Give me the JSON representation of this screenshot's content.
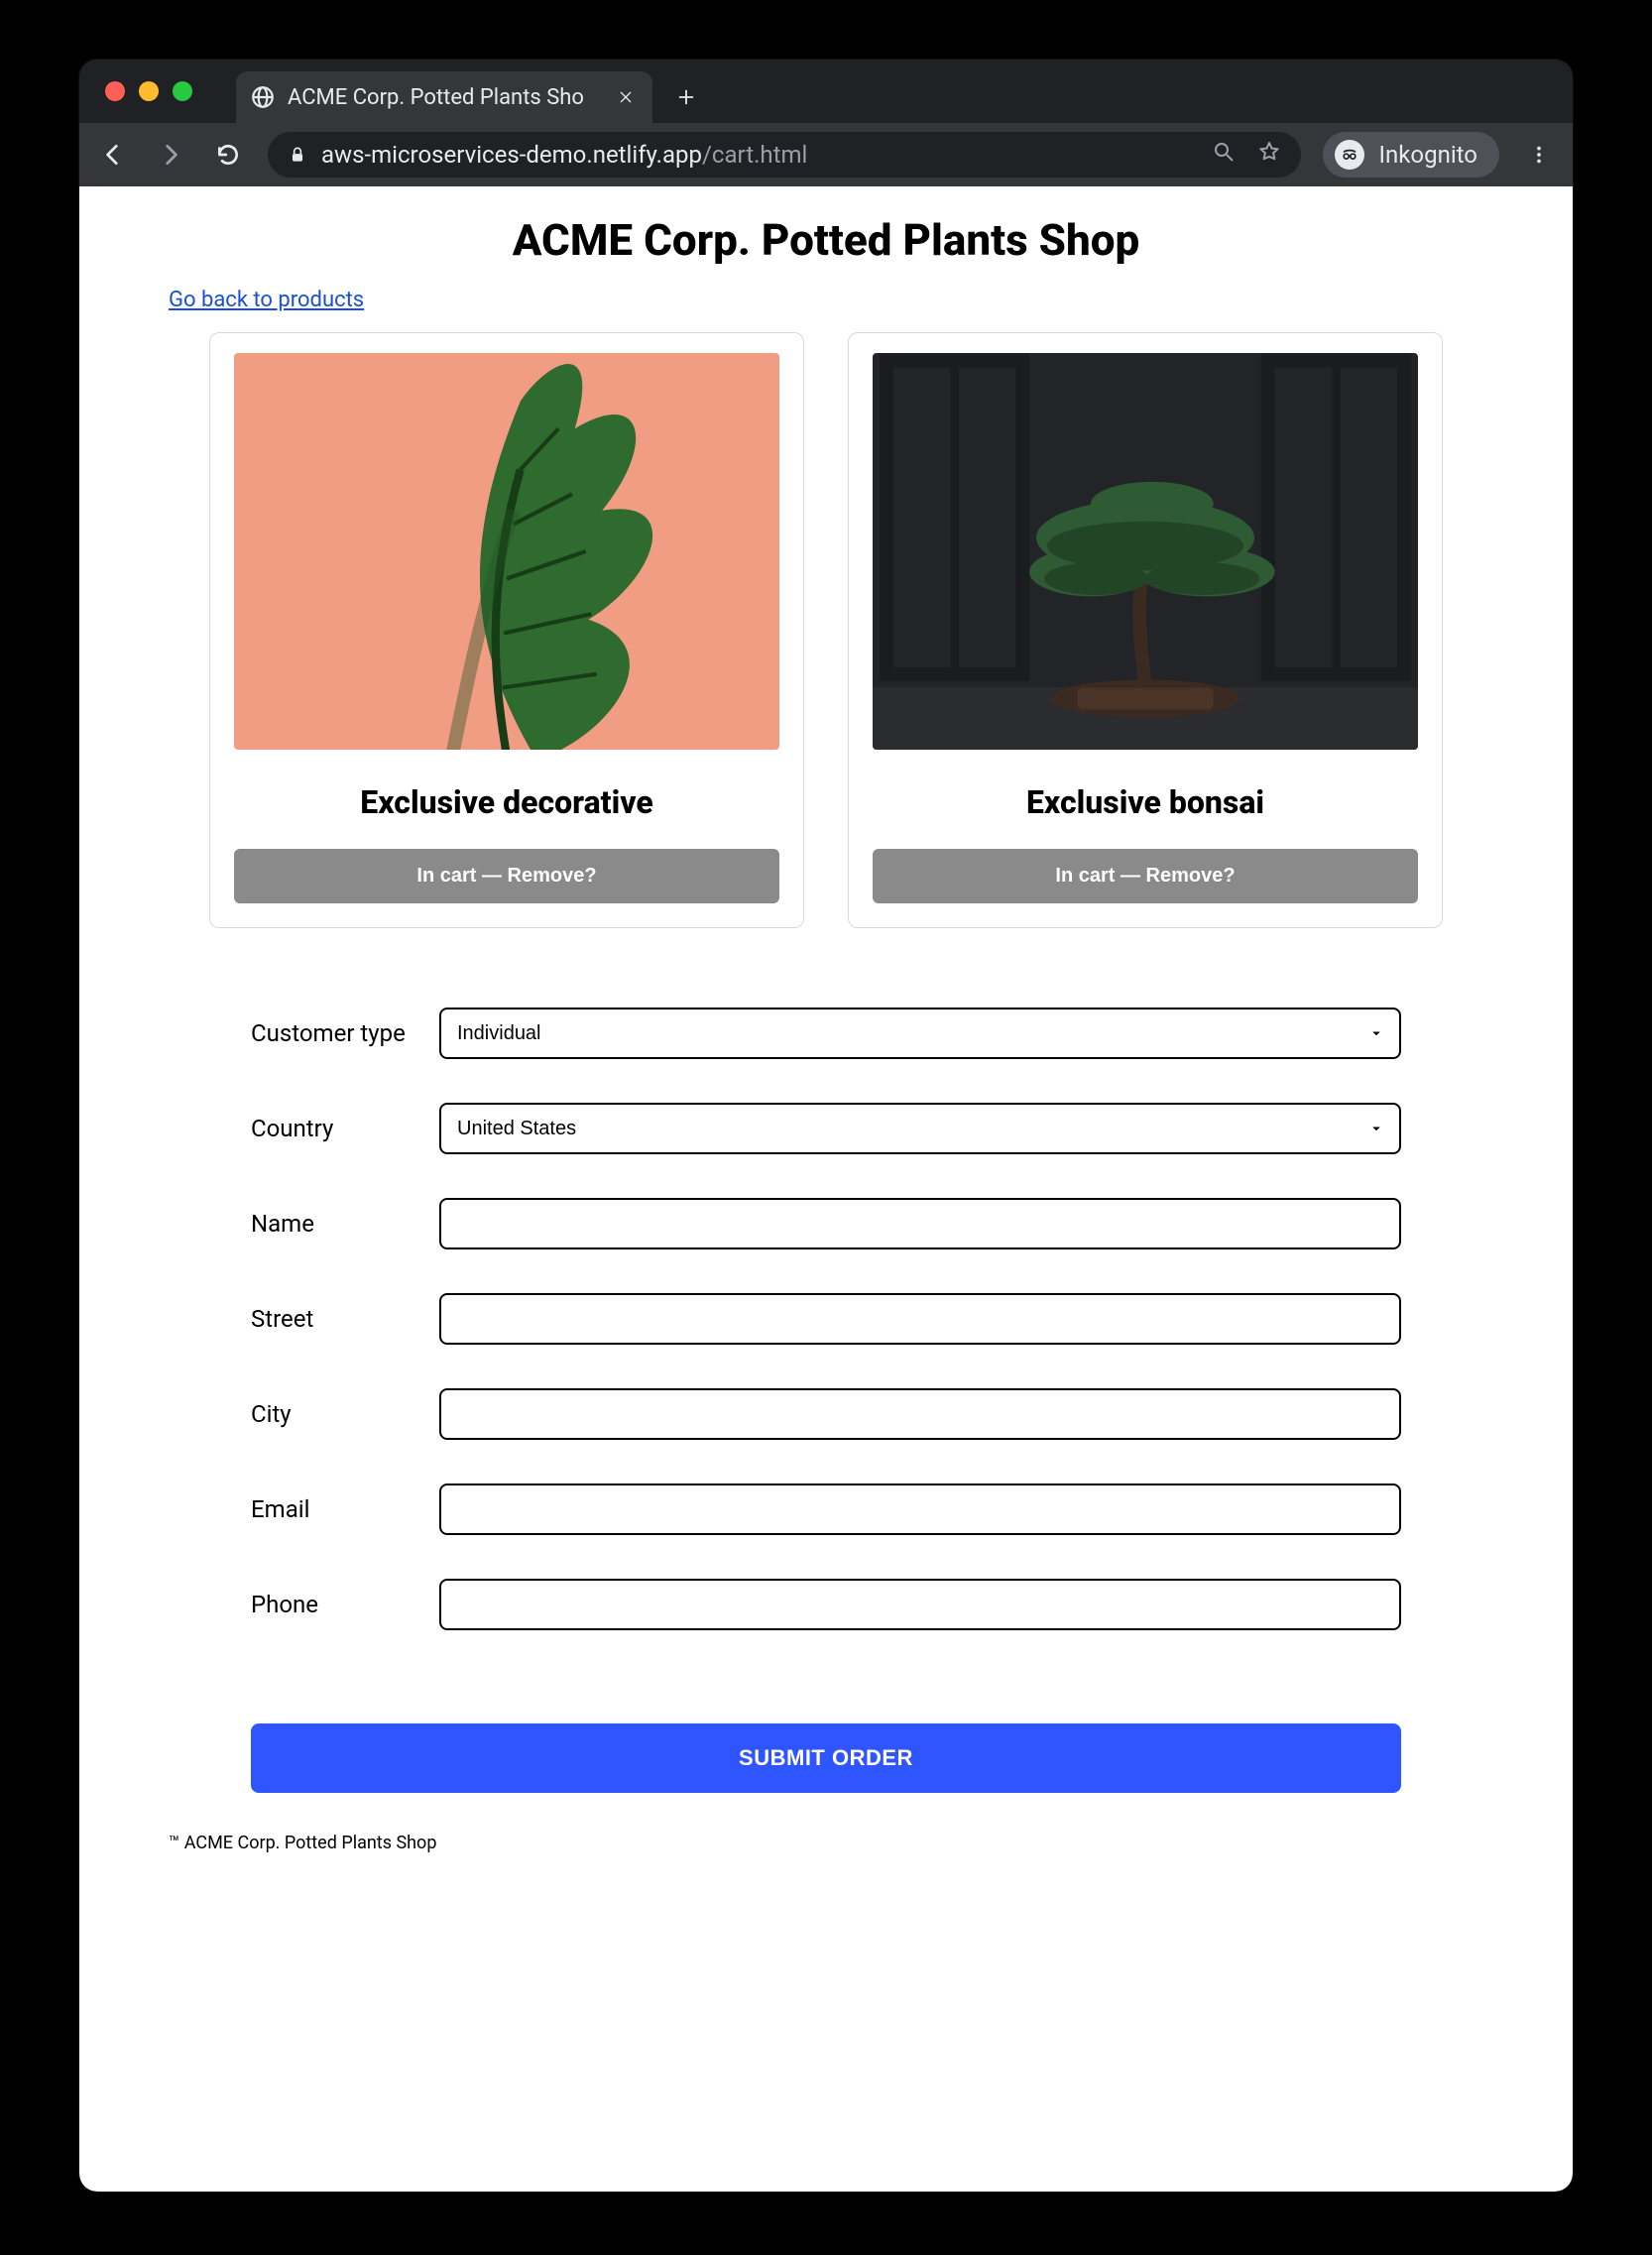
{
  "browser": {
    "tab_title": "ACME Corp. Potted Plants Sho",
    "url_display_host": "aws-microservices-demo.netlify.app",
    "url_display_path": "/cart.html",
    "incognito_label": "Inkognito"
  },
  "page": {
    "title": "ACME Corp. Potted Plants Shop",
    "back_link_label": "Go back to products"
  },
  "cart": {
    "items": [
      {
        "title": "Exclusive decorative",
        "button_label": "In cart — Remove?"
      },
      {
        "title": "Exclusive bonsai",
        "button_label": "In cart — Remove?"
      }
    ]
  },
  "form": {
    "customer_type": {
      "label": "Customer type",
      "value": "Individual"
    },
    "country": {
      "label": "Country",
      "value": "United States"
    },
    "name": {
      "label": "Name",
      "value": ""
    },
    "street": {
      "label": "Street",
      "value": ""
    },
    "city": {
      "label": "City",
      "value": ""
    },
    "email": {
      "label": "Email",
      "value": ""
    },
    "phone": {
      "label": "Phone",
      "value": ""
    },
    "submit_label": "SUBMIT ORDER"
  },
  "footer": {
    "trademark": "™ ACME Corp. Potted Plants Shop"
  }
}
